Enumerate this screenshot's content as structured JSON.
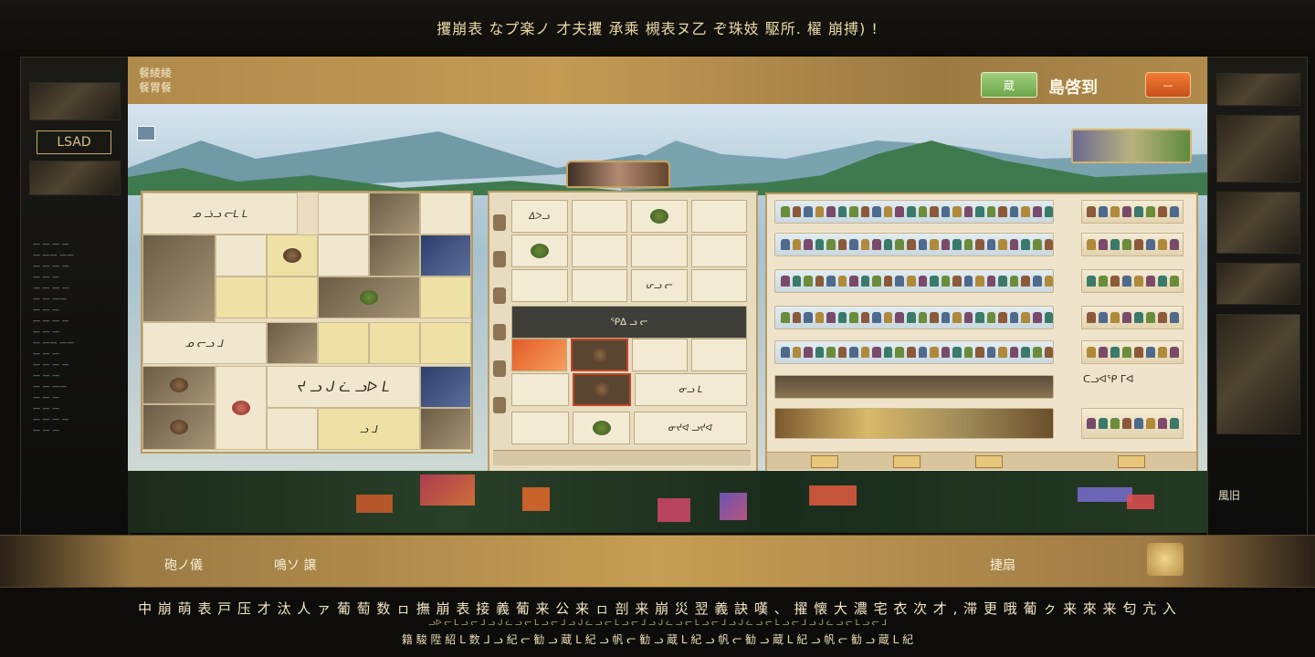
{
  "top_bar": {
    "title": "攫崩表 なプ楽ノ 才夫攫 承乘 槻表ヌ乙 ぞ珠妓 駆所. 櫂 崩搏) !"
  },
  "left_panel": {
    "logo": "LSAD",
    "menu": [
      "— — — —",
      "— —— ——",
      "— — — —",
      "— — —",
      "— — — —",
      "— — ——",
      "— — —",
      "— — — —",
      "— — —",
      "— —— ——",
      "— — —",
      "— — — —",
      "— — —",
      "— — ——",
      "— — —",
      "— — —",
      "— — — —",
      "— — —"
    ]
  },
  "right_panel": {
    "caption": "風旧"
  },
  "header": {
    "title_line1": "餐綾綾",
    "title_line2": "餐胃餐",
    "green_button": "蔵",
    "label": "島啓到",
    "orange_button": "—"
  },
  "grid_panel": {
    "cell_text_1": "ᓄ ᓘᓗ ᓕᒪ ᒪ",
    "cell_text_2": "ᓄ ᓕᓗ ᒧ",
    "cell_text_3": "ᔪ ᓗ ᒍ ᓛ ᓗᐅ ᒪ",
    "cell_text_4": "ᓗ ᒧ"
  },
  "center_panel": {
    "row1_text": "ᐃᐳᓗ",
    "row6_text": "ᕂᓗ ᓕ",
    "dark_bar_text": "ᕿᐃ ᓗ ᓕ",
    "row5_text": "ᓂᓗ ᒪ",
    "row7_text": "ᓂᔪᐊ ᓗᔪᐊ"
  },
  "shop_panel": {
    "label": "ᑕᓗᐊᕿ ᒥᐊ"
  },
  "bottom_bar": {
    "left_label": "砲ノ儀",
    "mid_label": "鳴ソ 譲",
    "right_label": "捷扇"
  },
  "credits": {
    "line1": "中 崩 萌 表 戸 压   才 汰 人 ァ 葡 萄 数 ㇿ 撫 崩 表 接 義 葡 来 公 来 ㇿ 剖 来 崩 災 翌 義 訣 嘆 、 擢 懐 大 濃 宅 衣 次 才 , 滞 更 哦   葡 ㇰ 来 來 来 匂 亢 入",
    "line2": "ᓗᐅ ᓕ ᒪ ᓗ ᓕ ᒧ ᓗ ᒍ ᓛ ᓗ ᓕ ᒪ ᓗ ᓕ ᒧ ᓗ ᒍ ᓛ ᓗ ᓕ ᒪ ᓗ ᓕ ᒧ ᓗ ᒍ ᓛ ᓗ ᓕ ᒪ ᓗ ᓕ ᒧ ᓗ ᒍ ᓛ ᓗ ᓕ ᒪ ᓗ ᓕ ᒧ ᓗ ᒍ ᓛ ᓗ ᓕ ᒪ ᓗ ᓕ ᒧ",
    "line3": "籍 駿 陞 紹 ᒪ 数 ᒧ ᓗ 紀 ᓕ 勧 ᓗ 蔵 ᒪ 紀 ᓗ 帆 ᓕ 勧 ᓗ 蔵 ᒪ 紀 ᓗ 帆 ᓕ 勧 ᓗ 蔵 ᒪ 紀 ᓗ 帆 ᓕ 勧 ᓗ 蔵 ᒪ 紀"
  },
  "colors": {
    "gold": "#c49a55",
    "green_button": "#7fb85a",
    "orange_button": "#e0662a",
    "panel_border": "#b99a63"
  }
}
